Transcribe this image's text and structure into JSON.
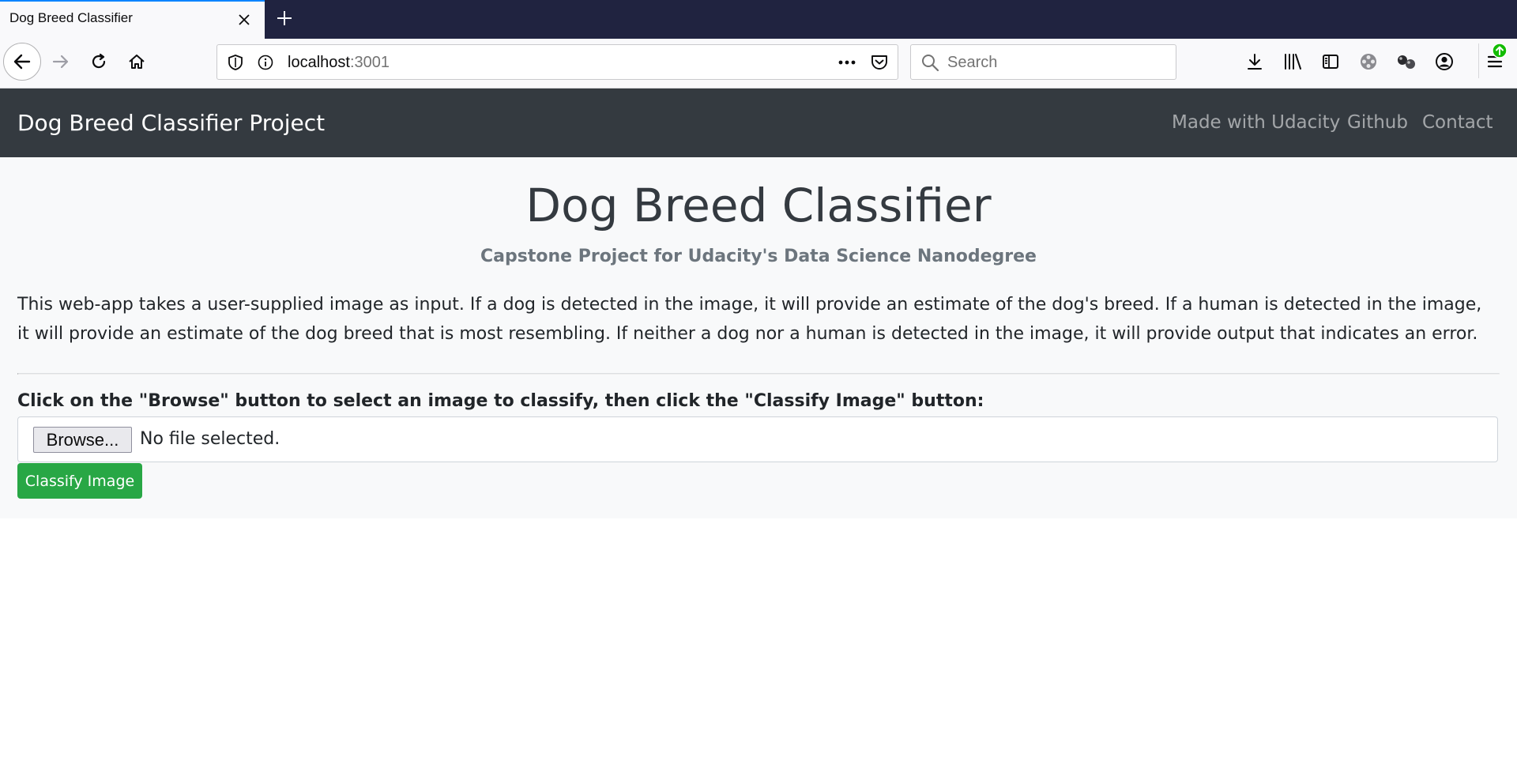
{
  "browser": {
    "tab_title": "Dog Breed Classifier",
    "url_host": "localhost",
    "url_port": ":3001",
    "search_placeholder": "Search"
  },
  "site": {
    "brand": "Dog Breed Classifier Project",
    "nav_links": [
      "Made with Udacity",
      "Github",
      "Contact"
    ]
  },
  "main": {
    "title": "Dog Breed Classifier",
    "subtitle": "Capstone Project for Udacity's Data Science Nanodegree",
    "description": "This web-app takes a user-supplied image as input. If a dog is detected in the image, it will provide an estimate of the dog's breed. If a human is detected in the image, it will provide an estimate of the dog breed that is most resembling. If neither a dog nor a human is detected in the image, it will provide output that indicates an error.",
    "instruction": "Click on the \"Browse\" button to select an image to classify, then click the \"Classify Image\" button:",
    "browse_label": "Browse...",
    "file_status": "No file selected.",
    "classify_label": "Classify Image"
  },
  "colors": {
    "navbar_bg": "#343a40",
    "jumbotron_bg": "#f8f9fa",
    "classify_button": "#28a745",
    "tabbar_bg": "#202340"
  }
}
